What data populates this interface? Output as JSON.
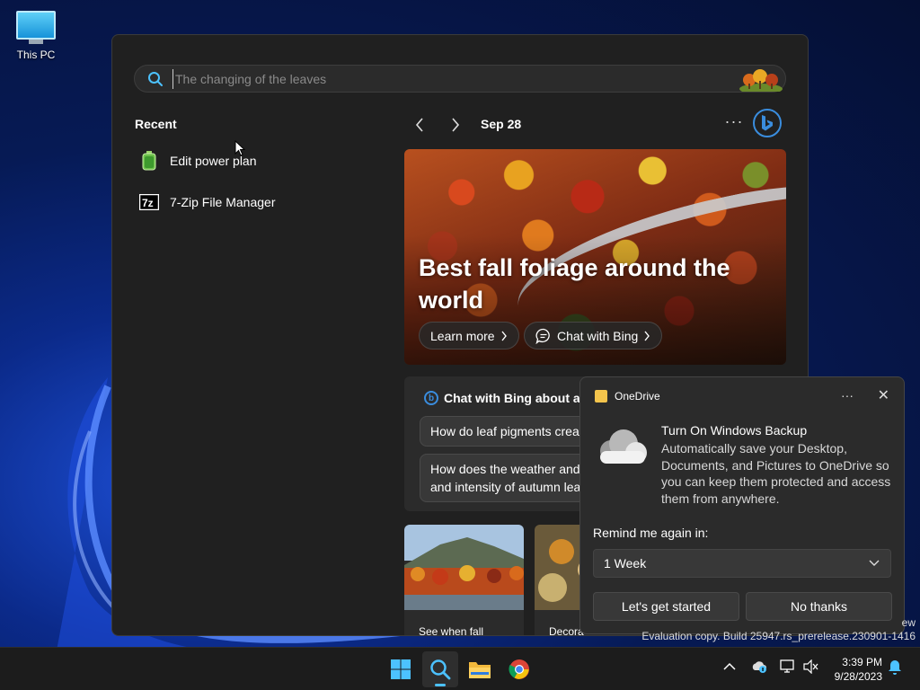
{
  "desktop": {
    "this_pc_label": "This PC"
  },
  "search": {
    "placeholder": "The changing of the leaves",
    "recent_title": "Recent",
    "recent_items": [
      {
        "label": "Edit power plan",
        "icon": "battery-icon"
      },
      {
        "label": "7-Zip File Manager",
        "icon": "7zip-icon"
      }
    ],
    "date": "Sep 28",
    "more_label": "···",
    "hero": {
      "headline": "Best fall foliage around the world",
      "learn_more": "Learn more",
      "chat_with_bing": "Chat with Bing"
    },
    "chat_card": {
      "title": "Chat with Bing about au",
      "question_1": "How do leaf pigments crea",
      "question_2_line1": "How does the weather and",
      "question_2_line2": "and intensity of autumn lea"
    },
    "thumbs": [
      {
        "caption": "See when fall"
      },
      {
        "caption": "Decora"
      }
    ]
  },
  "toast": {
    "app_name": "OneDrive",
    "title": "Turn On Windows Backup",
    "body": "Automatically save your Desktop, Documents, and Pictures to OneDrive so you can keep them protected and access them from anywhere.",
    "remind_label": "Remind me again in:",
    "remind_value": "1 Week",
    "primary_button": "Let's get started",
    "secondary_button": "No thanks",
    "more_label": "···",
    "close_label": "✕"
  },
  "watermark": {
    "line1": "ew",
    "line2": "Evaluation copy. Build 25947.rs_prerelease.230901-1416"
  },
  "taskbar": {
    "time": "3:39 PM",
    "date": "9/28/2023"
  },
  "colors": {
    "accent": "#4cc2ff",
    "bing_blue": "#3a8dde",
    "panel_bg": "#202020",
    "toast_bg": "#2b2b2b"
  }
}
